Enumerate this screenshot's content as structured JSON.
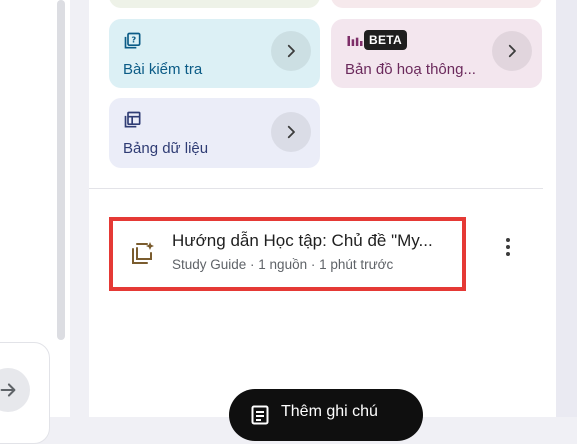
{
  "tiles": [
    {
      "label": "Bài kiểm tra",
      "icon": "quiz-icon"
    },
    {
      "label": "Bản đồ hoạ thông...",
      "icon": "infographic-icon",
      "badge": "BETA"
    },
    {
      "label": "Bảng dữ liệu",
      "icon": "data-table-icon"
    }
  ],
  "note": {
    "title": "Hướng dẫn Học tập: Chủ đề \"My...",
    "meta": "Study Guide · 1 nguồn · 1 phút trước",
    "icon": "study-guide-icon"
  },
  "add_note": {
    "label": "Thêm ghi chú",
    "icon": "note-icon"
  },
  "colors": {
    "quiz_tile": "#dcf0f5",
    "infographic_tile": "#f3e6ee",
    "table_tile": "#ebedf8",
    "highlight": "#e53935"
  }
}
